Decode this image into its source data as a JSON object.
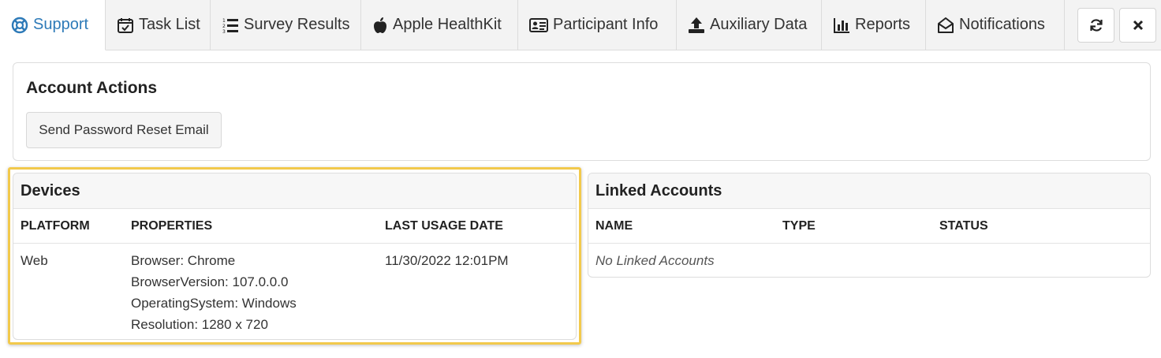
{
  "tabs": [
    {
      "label": "Support",
      "icon": "life-ring-icon",
      "active": true
    },
    {
      "label": "Task List",
      "icon": "calendar-check-icon"
    },
    {
      "label": "Survey Results",
      "icon": "list-numbered-icon"
    },
    {
      "label": "Apple HealthKit",
      "icon": "apple-icon"
    },
    {
      "label": "Participant Info",
      "icon": "id-card-icon"
    },
    {
      "label": "Auxiliary Data",
      "icon": "upload-icon"
    },
    {
      "label": "Reports",
      "icon": "bar-chart-icon"
    },
    {
      "label": "Notifications",
      "icon": "envelope-open-icon"
    }
  ],
  "toolbar": {
    "refresh_icon": "refresh-icon",
    "close_icon": "close-icon"
  },
  "account_actions": {
    "title": "Account Actions",
    "reset_button": "Send Password Reset Email"
  },
  "devices": {
    "title": "Devices",
    "columns": [
      "PLATFORM",
      "PROPERTIES",
      "LAST USAGE DATE"
    ],
    "rows": [
      {
        "platform": "Web",
        "properties": [
          "Browser: Chrome",
          "BrowserVersion: 107.0.0.0",
          "OperatingSystem: Windows",
          "Resolution: 1280 x 720"
        ],
        "last_usage": "11/30/2022 12:01PM"
      }
    ]
  },
  "linked_accounts": {
    "title": "Linked Accounts",
    "columns": [
      "NAME",
      "TYPE",
      "STATUS"
    ],
    "empty_text": "No Linked Accounts"
  },
  "colors": {
    "accent": "#2d7ab8",
    "highlight": "#f2c94c"
  }
}
